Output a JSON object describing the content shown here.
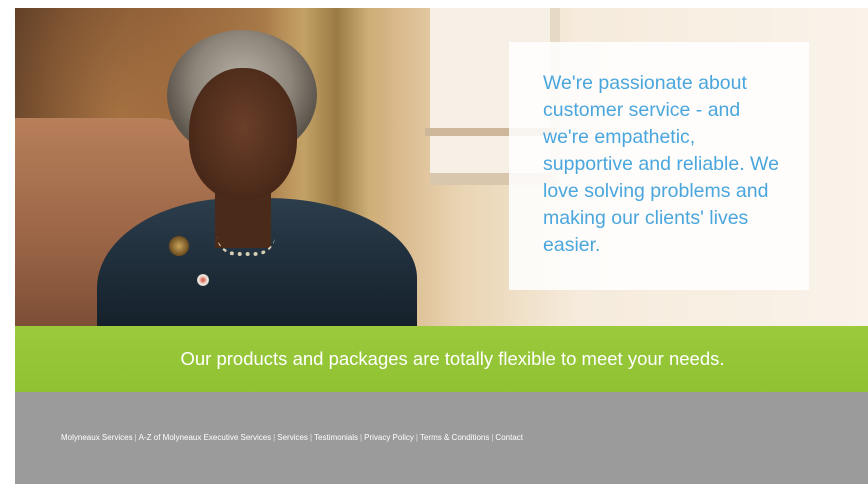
{
  "hero": {
    "quote": "We're passionate about customer service - and we're empathetic, supportive and reliable. We love solving problems and making our clients' lives easier."
  },
  "banner": {
    "text": "Our products and packages are totally flexible to meet your needs."
  },
  "footer": {
    "links": [
      "Molyneaux Services",
      "A-Z of Molyneaux Executive Services",
      "Services",
      "Testimonials",
      "Privacy Policy",
      "Terms & Conditions",
      "Contact"
    ]
  },
  "colors": {
    "quote_text": "#4aa6dd",
    "banner_green": "#94c437",
    "footer_grey": "#9b9b9b"
  }
}
